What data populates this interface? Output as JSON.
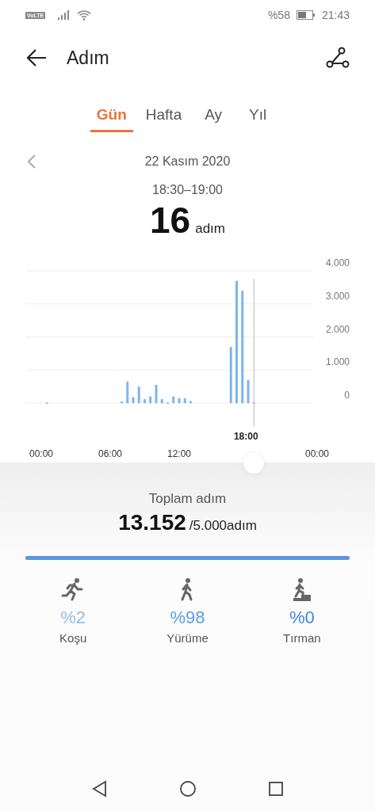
{
  "status_bar": {
    "network": "VoLTE",
    "battery": "%58",
    "time": "21:43"
  },
  "header": {
    "title": "Adım"
  },
  "tabs": [
    {
      "label": "Gün",
      "selected": true
    },
    {
      "label": "Hafta",
      "selected": false
    },
    {
      "label": "Ay",
      "selected": false
    },
    {
      "label": "Yıl",
      "selected": false
    }
  ],
  "date": "22 Kasım 2020",
  "selection": {
    "range": "18:30–19:00",
    "value": "16",
    "unit": "adım"
  },
  "chart_data": {
    "type": "bar",
    "x": [
      0.5,
      7,
      7.5,
      8,
      8.5,
      9,
      9.5,
      10,
      10.5,
      11,
      11.5,
      12,
      12.5,
      13,
      16.5,
      17,
      17.5,
      18,
      18.5
    ],
    "series": [
      {
        "color": "#7fb5ec",
        "values": [
          20,
          50,
          650,
          180,
          500,
          120,
          200,
          550,
          120,
          20,
          200,
          150,
          150,
          60,
          1700,
          3700,
          3400,
          700,
          20
        ]
      }
    ],
    "xlim": [
      0,
      24
    ],
    "ylim": [
      0,
      4000
    ],
    "grid": true,
    "ref_lines": [
      {
        "axis": "x",
        "value": 18.5,
        "label": "18:00"
      }
    ],
    "xticks": [
      {
        "value": 0,
        "label": "00:00"
      },
      {
        "value": 6,
        "label": "06:00"
      },
      {
        "value": 12,
        "label": "12:00"
      },
      {
        "value": 24,
        "label": "00:00"
      }
    ],
    "yticks": [
      {
        "value": 0,
        "label": "0"
      },
      {
        "value": 1000,
        "label": "1.000"
      },
      {
        "value": 2000,
        "label": "2.000"
      },
      {
        "value": 3000,
        "label": "3.000"
      },
      {
        "value": 4000,
        "label": "4.000"
      }
    ]
  },
  "summary": {
    "label": "Toplam adım",
    "total": "13.152",
    "goal": "/5.000adım",
    "level": 1
  },
  "activities": [
    {
      "kind": "run",
      "percent": "%2",
      "label": "Koşu",
      "color": "#8fbcea"
    },
    {
      "kind": "walk",
      "percent": "%98",
      "label": "Yürüme",
      "color": "#5a9be3"
    },
    {
      "kind": "climb",
      "percent": "%0",
      "label": "Tırman",
      "color": "#3f86d6"
    }
  ]
}
